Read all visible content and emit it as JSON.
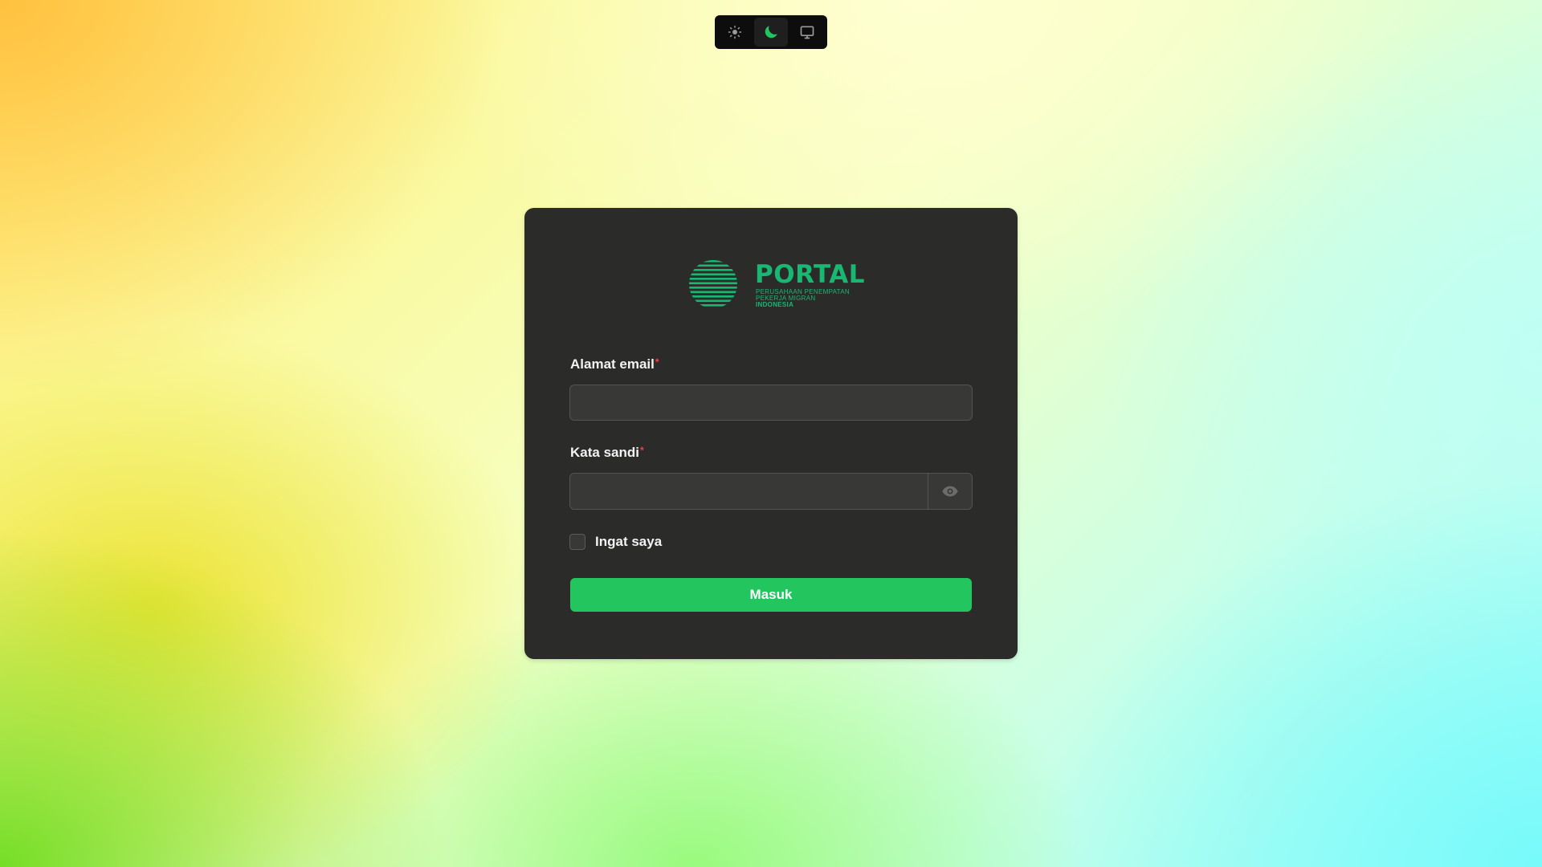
{
  "theme_switcher": {
    "options": [
      {
        "icon": "sun-icon",
        "active": false
      },
      {
        "icon": "moon-icon",
        "active": true
      },
      {
        "icon": "monitor-icon",
        "active": false
      }
    ],
    "active_color": "#22c55e"
  },
  "logo": {
    "title": "PORTAL",
    "subtitle_line1": "PERUSAHAAN PENEMPATAN",
    "subtitle_line2": "PEKERJA MIGRAN",
    "subtitle_line3": "INDONESIA",
    "color": "#18b873"
  },
  "form": {
    "email_label": "Alamat email",
    "email_required": "*",
    "email_value": "",
    "password_label": "Kata sandi",
    "password_required": "*",
    "password_value": "",
    "password_toggle_icon": "eye-icon",
    "remember_label": "Ingat saya",
    "remember_checked": false,
    "submit_label": "Masuk"
  },
  "colors": {
    "card_bg": "#2b2c2a",
    "primary": "#22c55e",
    "required": "#ef4444"
  }
}
